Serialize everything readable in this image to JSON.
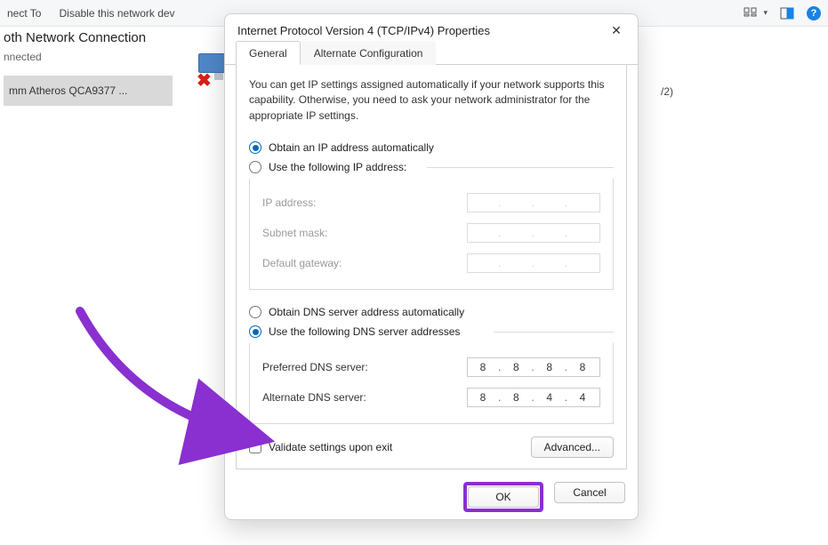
{
  "toolbar": {
    "connect_to": "nect To",
    "disable_device": "Disable this network dev"
  },
  "background": {
    "adapter_title": "oth Network Connection",
    "status": "nnected",
    "selected_item": "mm Atheros QCA9377 ...",
    "realtek_fragment": "/2)"
  },
  "dialog": {
    "title": "Internet Protocol Version 4 (TCP/IPv4) Properties",
    "tabs": {
      "general": "General",
      "alternate": "Alternate Configuration"
    },
    "info": "You can get IP settings assigned automatically if your network supports this capability. Otherwise, you need to ask your network administrator for the appropriate IP settings.",
    "ip_section": {
      "auto": "Obtain an IP address automatically",
      "manual": "Use the following IP address:",
      "ip_label": "IP address:",
      "mask_label": "Subnet mask:",
      "gw_label": "Default gateway:"
    },
    "dns_section": {
      "auto": "Obtain DNS server address automatically",
      "manual": "Use the following DNS server addresses",
      "preferred_label": "Preferred DNS server:",
      "preferred_value": [
        "8",
        "8",
        "8",
        "8"
      ],
      "alternate_label": "Alternate DNS server:",
      "alternate_value": [
        "8",
        "8",
        "4",
        "4"
      ]
    },
    "validate": "Validate settings upon exit",
    "advanced": "Advanced...",
    "ok": "OK",
    "cancel": "Cancel"
  }
}
